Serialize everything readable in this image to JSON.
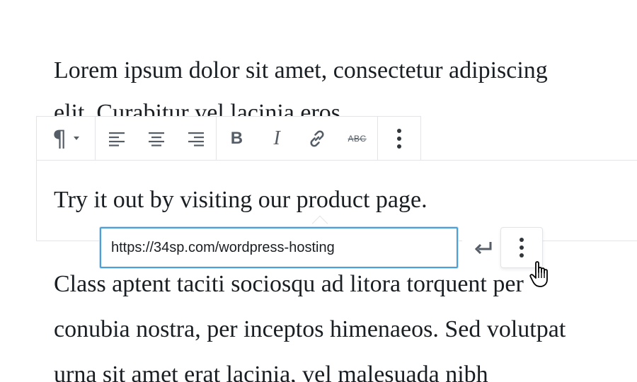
{
  "content": {
    "paragraph_1_line_1": "Lorem ipsum dolor sit amet, consectetur adipiscing",
    "paragraph_1_line_2": "elit. Curabitur vel lacinia eros.",
    "selected_block_text": "Try it out by visiting our product page.",
    "paragraph_3_line_1": "Class aptent taciti sociosqu ad litora torquent per",
    "paragraph_3_line_2": "conubia nostra, per inceptos himenaeos. Sed volutpat",
    "paragraph_3_line_3": "urna sit amet erat lacinia, vel malesuada nibh"
  },
  "toolbar": {
    "block_type": {
      "icon": "paragraph-icon",
      "symbol": "¶"
    },
    "alignment": [
      "align-left-icon",
      "align-center-icon",
      "align-right-icon"
    ],
    "formatting": {
      "bold": "B",
      "italic": "I",
      "link_icon": "link-icon",
      "strikethrough": "ABC"
    },
    "more_icon": "more-options-icon"
  },
  "link_popover": {
    "url_value": "https://34sp.com/wordpress-hosting",
    "submit_icon": "enter-icon",
    "more_icon": "more-options-icon"
  },
  "colors": {
    "text": "#191e23",
    "icon": "#555d66",
    "border": "#e2e4e7",
    "input_focus": "#4ca0d9"
  }
}
